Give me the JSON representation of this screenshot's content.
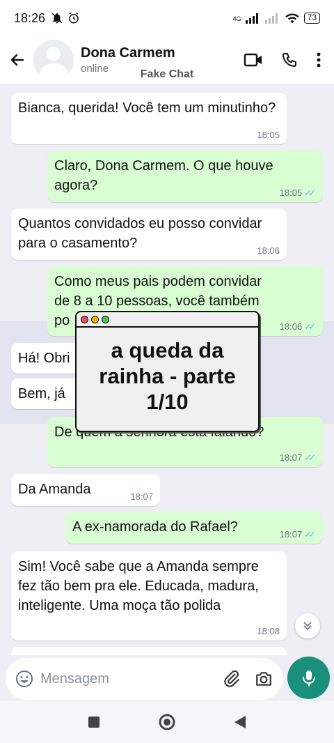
{
  "status_bar": {
    "time": "18:26",
    "network": "4G",
    "battery": "73"
  },
  "header": {
    "contact_name": "Dona Carmem",
    "contact_status": "online",
    "watermark": "Fake Chat"
  },
  "messages": [
    {
      "dir": "in",
      "text": "Bianca, querida! Você tem um minutinho?",
      "time": "18:05"
    },
    {
      "dir": "out",
      "text": "Claro, Dona Carmem. O que houve agora?",
      "time": "18:05",
      "read": true
    },
    {
      "dir": "in",
      "text": "Quantos convidados eu posso convidar para o casamento?",
      "time": "18:06"
    },
    {
      "dir": "out",
      "text": "Como meus pais podem convidar de 8 a 10 pessoas, você também po",
      "time": "18:06",
      "read": true
    },
    {
      "dir": "in",
      "text": "Há! Obri",
      "time": ""
    },
    {
      "dir": "in",
      "text": "Bem, já",
      "time": ""
    },
    {
      "dir": "out",
      "text": "De quem a senhora está falando?",
      "time": "18:07",
      "read": true
    },
    {
      "dir": "in",
      "text": "Da Amanda",
      "time": "18:07"
    },
    {
      "dir": "out",
      "text": "A ex-namorada do Rafael?",
      "time": "18:07",
      "read": true
    },
    {
      "dir": "in",
      "text": "Sim! Você sabe que a Amanda sempre fez tão bem pra ele. Educada, madura, inteligente. Uma moça tão polida",
      "time": "18:08"
    }
  ],
  "overlay": {
    "title": "a queda da rainha - parte 1/10"
  },
  "composer": {
    "placeholder": "Mensagem"
  },
  "colors": {
    "accent": "#1a8f7b",
    "outgoing_bubble": "#d9fdd3",
    "incoming_bubble": "#ffffff",
    "read_ticks": "#53bdeb"
  }
}
